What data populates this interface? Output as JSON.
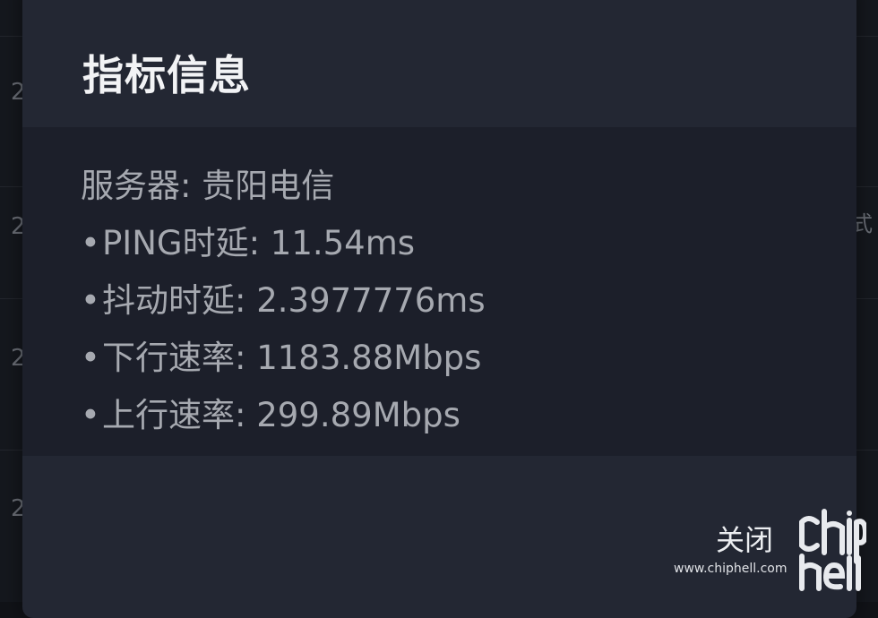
{
  "background": {
    "row_digits": [
      "2",
      "2",
      "2",
      "2"
    ],
    "right_text": "式"
  },
  "dialog": {
    "title": "指标信息",
    "lines": [
      {
        "bullet": "",
        "text": "服务器: 贵阳电信"
      },
      {
        "bullet": "•",
        "text": "PING时延: 11.54ms"
      },
      {
        "bullet": "•",
        "text": "抖动时延: 2.3977776ms"
      },
      {
        "bullet": "•",
        "text": "下行速率: 1183.88Mbps"
      },
      {
        "bullet": "•",
        "text": "上行速率: 299.89Mbps"
      }
    ],
    "close_label": "关闭"
  },
  "watermark": {
    "logo_text": "chiphell",
    "url": "www.chiphell.com"
  },
  "colors": {
    "dialog_bg": "#232733",
    "panel_bg": "#1c1f2a",
    "title": "#f2f3f5",
    "body_text": "#a6a9b0"
  }
}
